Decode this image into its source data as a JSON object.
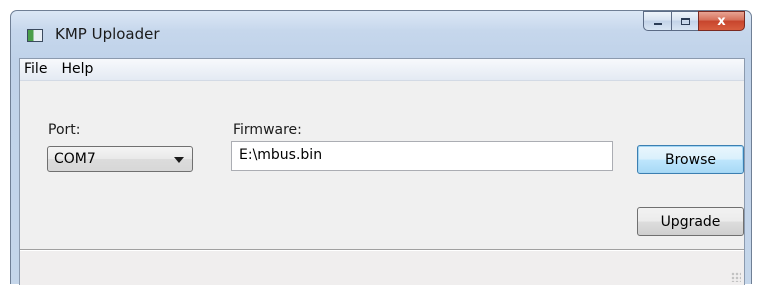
{
  "window": {
    "title": "KMP Uploader",
    "caption_close": "x"
  },
  "menu": {
    "items": [
      "File",
      "Help"
    ]
  },
  "port": {
    "label": "Port:",
    "selected": "COM7"
  },
  "firmware": {
    "label": "Firmware:",
    "value": "E:\\mbus.bin"
  },
  "buttons": {
    "browse": "Browse",
    "upgrade": "Upgrade"
  },
  "colors": {
    "title_bar": "#c6d7ec",
    "close_button": "#c7452d",
    "client_background": "#f0f0f0",
    "focused_button_border": "#3c7fb1"
  },
  "icons": {
    "app": "app-window-icon",
    "minimize": "minimize-icon",
    "maximize": "maximize-icon",
    "close": "close-icon",
    "dropdown": "chevron-down-icon",
    "grip": "resize-grip-icon"
  }
}
